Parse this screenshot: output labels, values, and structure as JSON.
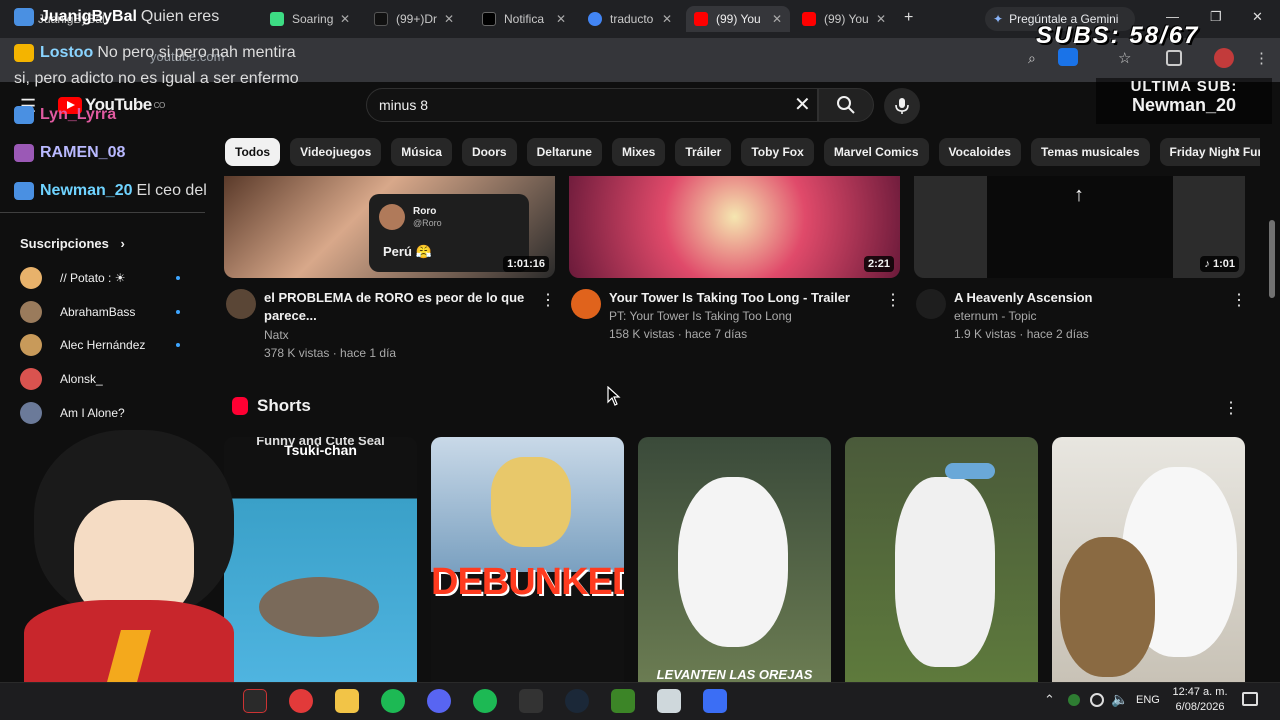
{
  "browser": {
    "tabs": [
      {
        "label": "JuanigByBal",
        "color": "#3f51b5"
      },
      {
        "label": "Soaring",
        "color": "#3ddc84"
      },
      {
        "label": "(99+)Dr",
        "color": "#111111"
      },
      {
        "label": "Notifica",
        "color": "#000000"
      },
      {
        "label": "traducto",
        "color": "#4285f4"
      },
      {
        "label": "(99) You",
        "color": "#ff0000"
      },
      {
        "label": "(99) You",
        "color": "#ff0000"
      }
    ],
    "new_tab": "+",
    "gemini_label": "Pregúntale a Gemini",
    "url": "youtube.com"
  },
  "youtube": {
    "logo": "YouTube",
    "country": "CO",
    "search_value": "minus 8",
    "chips": [
      "Todos",
      "Videojuegos",
      "Música",
      "Doors",
      "Deltarune",
      "Mixes",
      "Tráiler",
      "Toby Fox",
      "Marvel Comics",
      "Vocaloides",
      "Temas musicales",
      "Friday Night Funki"
    ],
    "sidebar": {
      "subs_title": "Suscripciones",
      "subs_chevron": "›",
      "items": [
        {
          "name": "// Potato : ☀",
          "color": "#e8b26b"
        },
        {
          "name": "AbrahamBass",
          "color": "#9a7b5c"
        },
        {
          "name": "Alec Hernández",
          "color": "#c89a5a"
        },
        {
          "name": "Alonsk_",
          "color": "#d9534f"
        },
        {
          "name": "Am I Alone?",
          "color": "#6b7a99"
        }
      ]
    },
    "videos": [
      {
        "title": "el PROBLEMA de RORO es peor de lo que parece...",
        "channel": "Natx",
        "meta": "378 K vistas · hace 1 día",
        "duration": "1:01:16",
        "thumb_overlay_name": "Roro",
        "thumb_overlay_handle": "@Roro",
        "thumb_overlay_text": "Perú 😤"
      },
      {
        "title": "Your Tower Is Taking Too Long - Trailer",
        "channel": "PT: Your Tower Is Taking Too Long",
        "meta": "158 K vistas · hace 7 días",
        "duration": "2:21"
      },
      {
        "title": "A Heavenly Ascension",
        "channel": "eternum - Topic",
        "meta": "1.9 K vistas · hace 2 días",
        "duration": "♪ 1:01"
      }
    ],
    "shorts_title": "Shorts",
    "shorts": [
      {
        "caption_top": "Funny and Cute Seal",
        "caption": "Tsuki-chan",
        "bg": "#3aa0c8"
      },
      {
        "caption": "DEBUNKED",
        "bg": "#8fb8d8"
      },
      {
        "caption": "LEVANTEN LAS OREJAS",
        "bg": "#6b7c52"
      },
      {
        "caption": "",
        "bg": "#5e7a3c"
      },
      {
        "caption": "",
        "bg": "#d8d2c6"
      }
    ]
  },
  "stream_overlay": {
    "subs_counter": "SUBS: 58/67",
    "last_sub_label": "ULTIMA SUB:",
    "last_sub_name": "Newman_20",
    "chat": [
      {
        "user": "JuanigByBal",
        "msg": "Quien eres",
        "color": "#ffffff"
      },
      {
        "user": "Lostoo",
        "msg": "No pero si pero nah mentira",
        "color": "#8ad4ff"
      },
      {
        "user": "",
        "msg": "si, pero adicto no es igual a ser enfermo",
        "color": "#ffffff"
      },
      {
        "user": "Lyn_Lyrra",
        "msg": "",
        "color": "#e05aa0"
      },
      {
        "user": "RAMEN_08",
        "msg": "",
        "color": "#b9b9ff"
      },
      {
        "user": "Newman_20",
        "msg": "El ceo del",
        "color": "#6fd3ff"
      }
    ]
  },
  "taskbar": {
    "lang": "ENG",
    "time": "12:47 a. m.",
    "date": "6/08/2026"
  }
}
